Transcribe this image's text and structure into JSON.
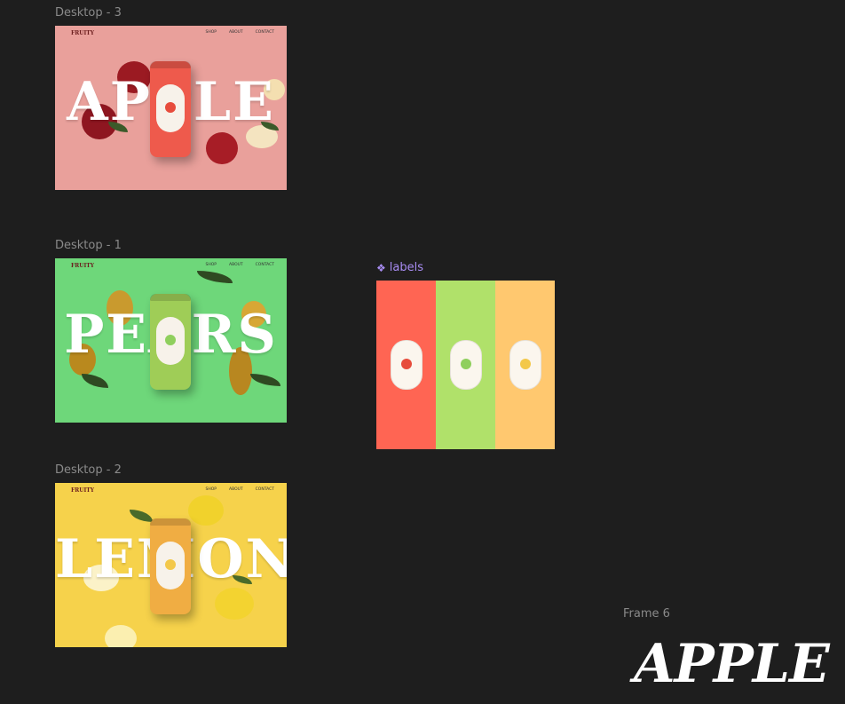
{
  "frames": [
    {
      "title": "Desktop - 3",
      "logo": "FRUITY",
      "nav": [
        "SHOP",
        "ABOUT",
        "CONTACT"
      ],
      "word": "APPLE",
      "bg": "#e9a09b",
      "can": "#ee5a4c",
      "fruit": "#a71d26"
    },
    {
      "title": "Desktop - 1",
      "logo": "FRUITY",
      "nav": [
        "SHOP",
        "ABOUT",
        "CONTACT"
      ],
      "word": "PEARS",
      "bg": "#6ed77a",
      "can": "#9fcd57",
      "fruit": "#c7982c"
    },
    {
      "title": "Desktop - 2",
      "logo": "FRUITY",
      "nav": [
        "SHOP",
        "ABOUT",
        "CONTACT"
      ],
      "word": "LEMON",
      "bg": "#f6d24b",
      "can": "#f0ad43",
      "fruit": "#f3d330"
    }
  ],
  "component": {
    "name": "labels",
    "icon": "component-icon",
    "swatches": [
      {
        "bg": "#ff6553",
        "fruit": "#e74c3c",
        "title_color": "#e35a4a"
      },
      {
        "bg": "#b0e16a",
        "fruit": "#8fcf5d",
        "title_color": "#3c8a45"
      },
      {
        "bg": "#ffc86f",
        "fruit": "#f3c84a",
        "title_color": "#e39c2d"
      }
    ]
  },
  "frame6": {
    "title": "Frame 6",
    "word": "APPLE"
  }
}
